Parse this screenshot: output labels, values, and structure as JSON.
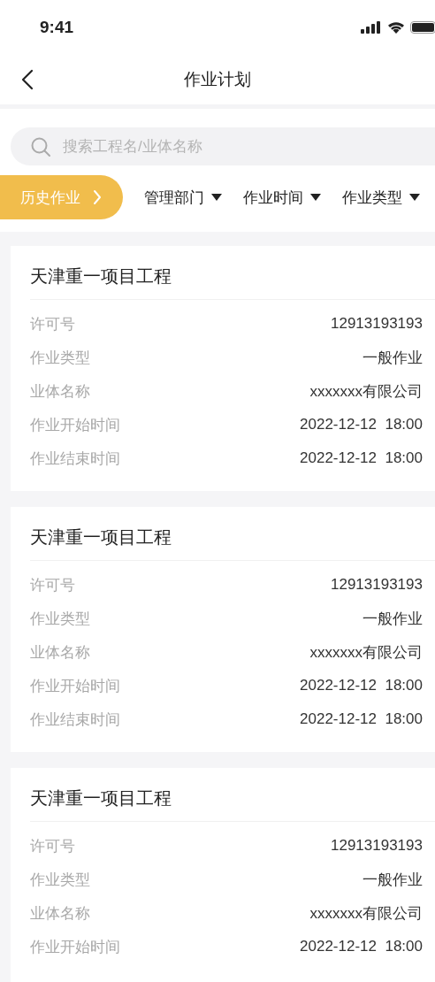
{
  "status_bar": {
    "time": "9:41"
  },
  "nav": {
    "title": "作业计划"
  },
  "search": {
    "placeholder": "搜索工程名/业体名称"
  },
  "history_button": {
    "label": "历史作业"
  },
  "filters": [
    {
      "label": "管理部门"
    },
    {
      "label": "作业时间"
    },
    {
      "label": "作业类型"
    }
  ],
  "cards": [
    {
      "title": "天津重一项目工程",
      "fields": [
        {
          "label": "许可号",
          "value": "12913193193"
        },
        {
          "label": "作业类型",
          "value": "一般作业"
        },
        {
          "label": "业体名称",
          "value": "xxxxxxx有限公司"
        },
        {
          "label": "作业开始时间",
          "value": "2022-12-12  18:00"
        },
        {
          "label": "作业结束时间",
          "value": "2022-12-12  18:00"
        }
      ]
    },
    {
      "title": "天津重一项目工程",
      "fields": [
        {
          "label": "许可号",
          "value": "12913193193"
        },
        {
          "label": "作业类型",
          "value": "一般作业"
        },
        {
          "label": "业体名称",
          "value": "xxxxxxx有限公司"
        },
        {
          "label": "作业开始时间",
          "value": "2022-12-12  18:00"
        },
        {
          "label": "作业结束时间",
          "value": "2022-12-12  18:00"
        }
      ]
    },
    {
      "title": "天津重一项目工程",
      "fields": [
        {
          "label": "许可号",
          "value": "12913193193"
        },
        {
          "label": "作业类型",
          "value": "一般作业"
        },
        {
          "label": "业体名称",
          "value": "xxxxxxx有限公司"
        },
        {
          "label": "作业开始时间",
          "value": "2022-12-12  18:00"
        }
      ]
    }
  ]
}
